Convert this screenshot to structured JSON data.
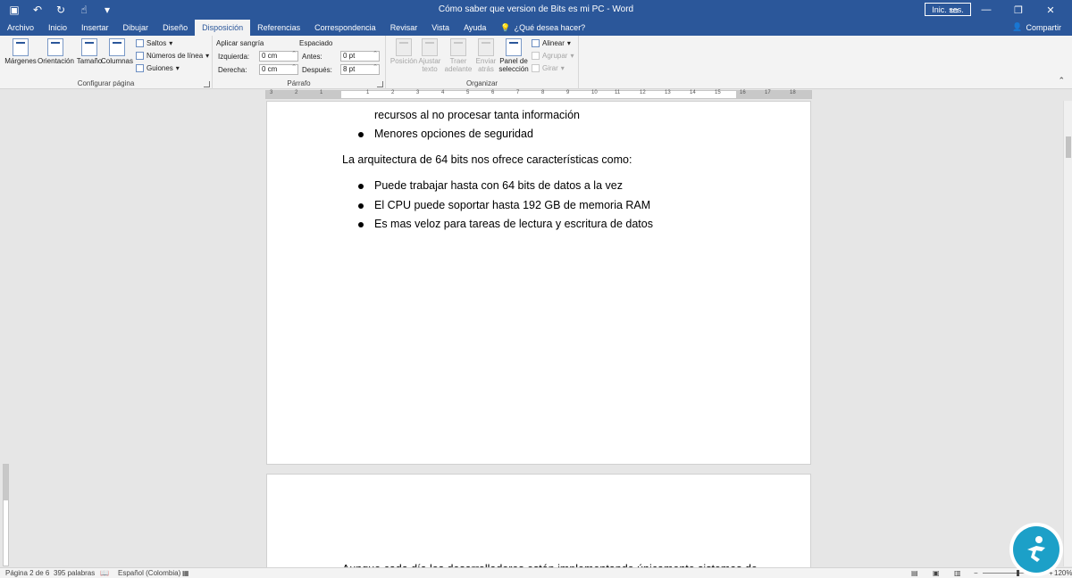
{
  "titlebar": {
    "title": "Cómo saber que version de Bits es mi PC  -  Word",
    "signin_label": "Inic. ses.",
    "minimize": "—",
    "restore": "❐",
    "close": "✕"
  },
  "tabs": [
    "Archivo",
    "Inicio",
    "Insertar",
    "Dibujar",
    "Diseño",
    "Disposición",
    "Referencias",
    "Correspondencia",
    "Revisar",
    "Vista",
    "Ayuda"
  ],
  "tell_me": "¿Qué desea hacer?",
  "share_label": "Compartir",
  "ribbon": {
    "configurar": {
      "label": "Configurar página",
      "margenes": "Márgenes",
      "orientacion": "Orientación",
      "tamano": "Tamaño",
      "columnas": "Columnas",
      "saltos": "Saltos",
      "numeros_linea": "Números de línea",
      "guiones": "Guiones"
    },
    "parrafo": {
      "label": "Párrafo",
      "aplicar_sangria": "Aplicar sangría",
      "izquierda": "Izquierda:",
      "izquierda_val": "0 cm",
      "derecha": "Derecha:",
      "derecha_val": "0 cm",
      "espaciado": "Espaciado",
      "antes": "Antes:",
      "antes_val": "0 pt",
      "despues": "Después:",
      "despues_val": "8 pt"
    },
    "organizar": {
      "label": "Organizar",
      "posicion": "Posición",
      "ajustar_1": "Ajustar",
      "ajustar_2": "texto",
      "traer_1": "Traer",
      "traer_2": "adelante",
      "enviar_1": "Enviar",
      "enviar_2": "atrás",
      "panel_1": "Panel de",
      "panel_2": "selección",
      "alinear": "Alinear",
      "agrupar": "Agrupar",
      "girar": "Girar"
    }
  },
  "ruler_numbers": [
    "3",
    "2",
    "1",
    "1",
    "2",
    "3",
    "4",
    "5",
    "6",
    "7",
    "8",
    "9",
    "10",
    "11",
    "12",
    "13",
    "14",
    "15",
    "16",
    "17",
    "18"
  ],
  "document": {
    "line_cut": "recursos al no procesar tanta información",
    "bullet_1": "Menores opciones de seguridad",
    "paragraph": "La arquitectura de 64 bits nos ofrece características como:",
    "bullets_64": [
      "Puede trabajar hasta con 64 bits de datos a la vez",
      "El CPU puede soportar hasta 192 GB de memoria RAM",
      "Es mas veloz para tareas de lectura y escritura de datos"
    ],
    "page2_line": "Aunque cada día los desarrolladores están implementando únicamente sistemas de"
  },
  "status": {
    "page": "Página 2 de 6",
    "words": "395 palabras",
    "language": "Español (Colombia)",
    "zoom": "120%"
  },
  "colors": {
    "accent": "#2b579a",
    "logo": "#1ca0c8"
  }
}
